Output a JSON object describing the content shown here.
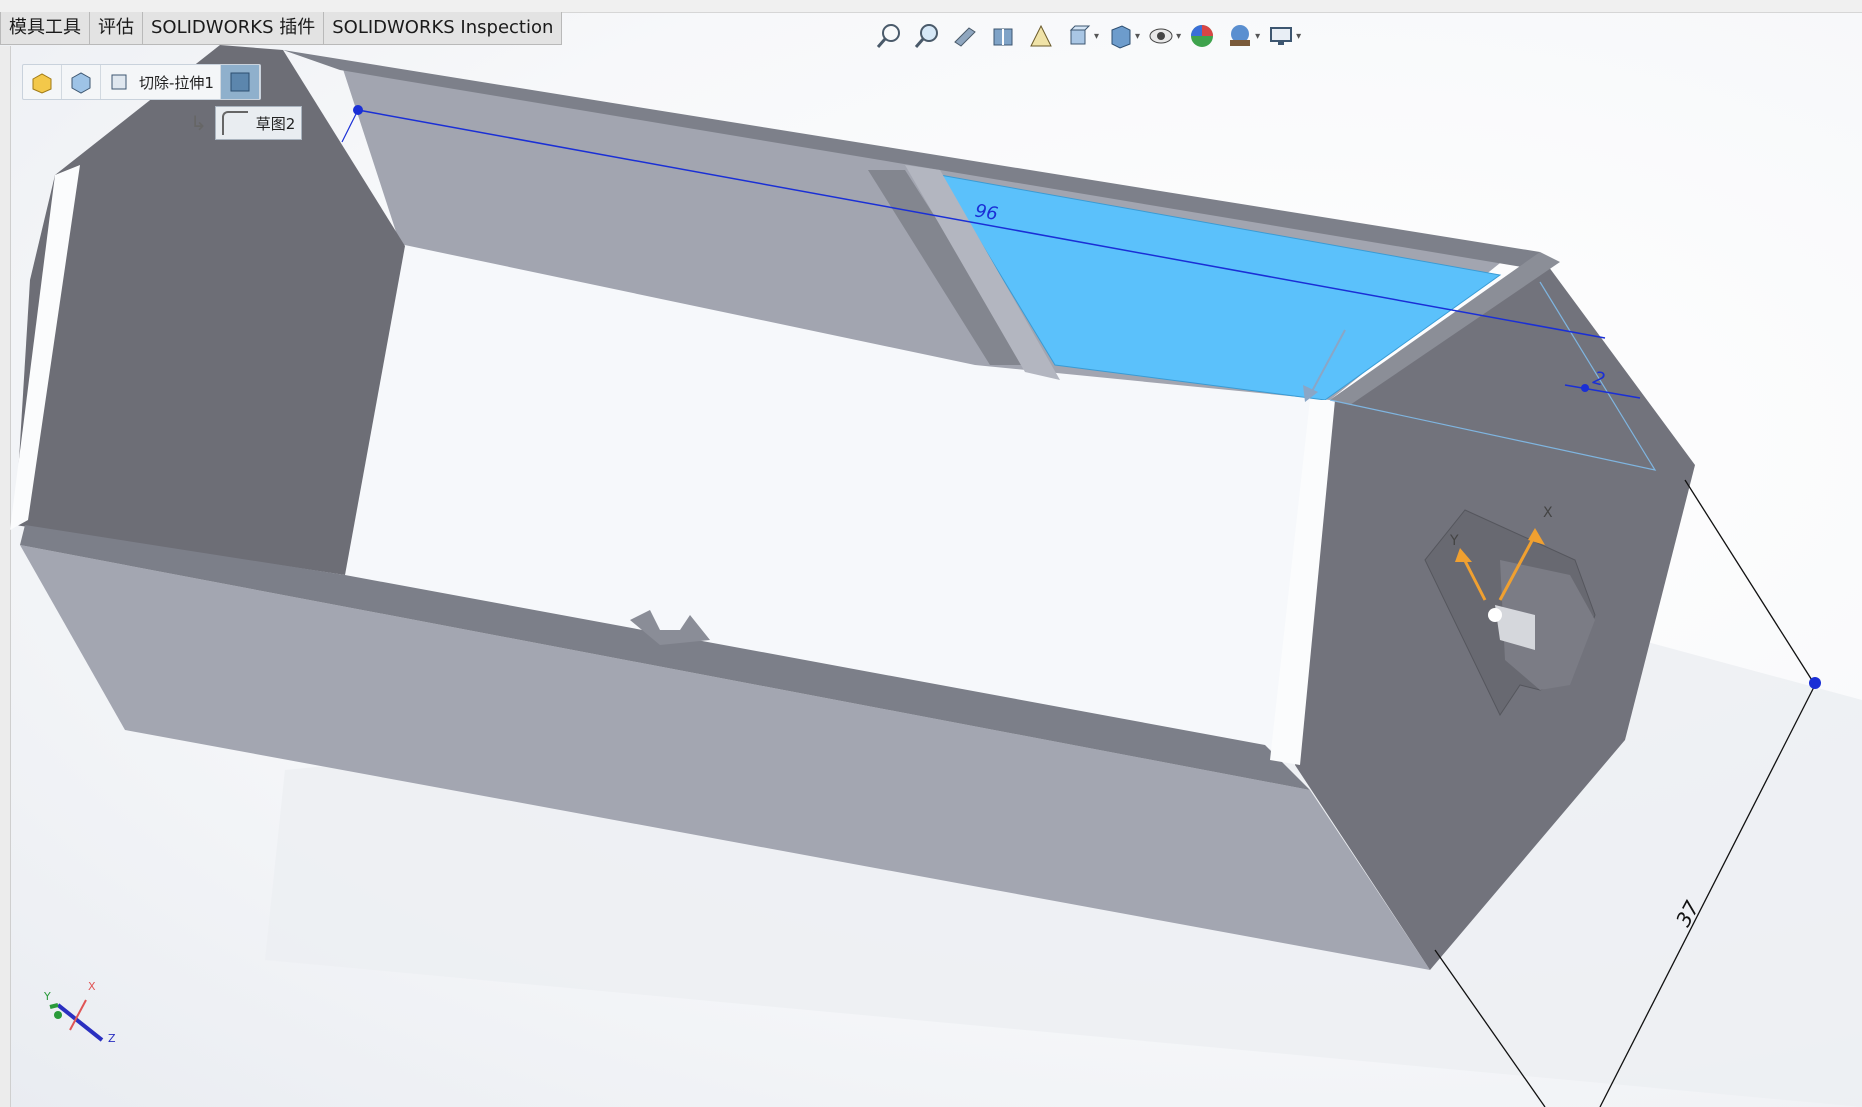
{
  "tabs": [
    "模具工具",
    "评估",
    "SOLIDWORKS 插件",
    "SOLIDWORKS Inspection"
  ],
  "view_toolbar": {
    "icons": [
      "zoom-to-fit-icon",
      "zoom-to-area-icon",
      "previous-view-icon",
      "section-view-icon",
      "dynamic-annotation-icon",
      "view-orientation-icon",
      "display-style-icon",
      "hide-show-items-icon",
      "edit-appearance-icon",
      "apply-scene-icon",
      "view-settings-icon"
    ]
  },
  "breadcrumb": {
    "feature_label": "切除-拉伸1",
    "sketch_label": "草图2"
  },
  "dimensions": {
    "length": "96",
    "offset": "2",
    "width": "37"
  },
  "triad": {
    "x": "X",
    "y": "Y",
    "z": "Z"
  },
  "colors": {
    "body_face": "#9fa2ad",
    "dark_face": "#6f7078",
    "selected_face": "#5bc1fb",
    "dimension_line": "#1a2fd6",
    "triad_arrow": "#f0a030"
  }
}
